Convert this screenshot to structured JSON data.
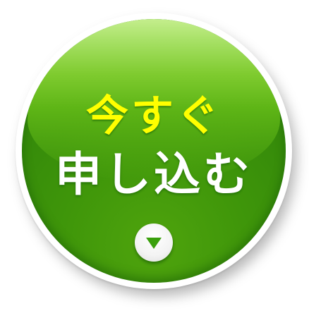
{
  "cta": {
    "line1": "今すぐ",
    "line2": "申し込む",
    "arrow_icon": "triangle-down-icon",
    "colors": {
      "line1_text": "#ffff00",
      "line2_text": "#ffffff",
      "button_green": "#3f960a",
      "arrow_green": "#3aa00c"
    }
  }
}
